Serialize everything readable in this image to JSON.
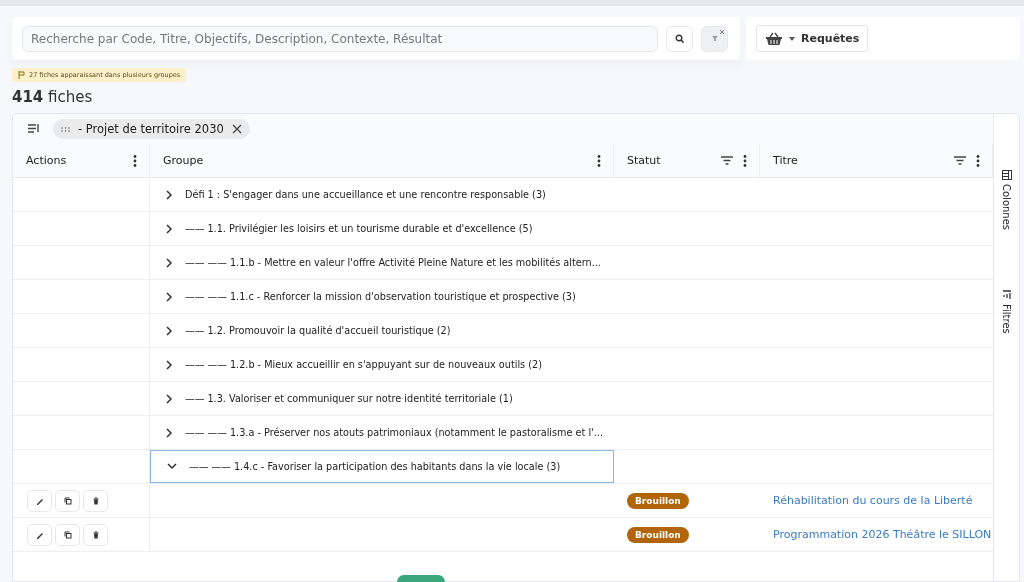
{
  "search": {
    "placeholder": "Recherche par Code, Titre, Objectifs, Description, Contexte, Résultat"
  },
  "requests_button": {
    "label": "Requêtes"
  },
  "notice": "27 fiches apparaissant dans plusieurs groupes",
  "count": {
    "number": "414",
    "label": "fiches"
  },
  "grouping_chip": {
    "label": "- Projet de territoire 2030"
  },
  "table": {
    "columns": [
      {
        "label": "Actions",
        "filter": false
      },
      {
        "label": "Groupe",
        "filter": false
      },
      {
        "label": "Statut",
        "filter": true
      },
      {
        "label": "Titre",
        "filter": true
      }
    ],
    "rows": [
      {
        "kind": "group",
        "label": "Défi 1 : S'engager dans une accueillance et une rencontre responsable (3)",
        "expanded": false,
        "selected": false
      },
      {
        "kind": "group",
        "label": "—— 1.1. Privilégier les loisirs et un tourisme durable et d'excellence (5)",
        "expanded": false,
        "selected": false
      },
      {
        "kind": "group",
        "label": "—— —— 1.1.b - Mettre en valeur l'offre Activité Pleine Nature et les mobilités altern...",
        "expanded": false,
        "selected": false
      },
      {
        "kind": "group",
        "label": "—— —— 1.1.c - Renforcer la mission d'observation touristique et prospective (3)",
        "expanded": false,
        "selected": false
      },
      {
        "kind": "group",
        "label": "—— 1.2. Promouvoir la qualité d'accueil touristique (2)",
        "expanded": false,
        "selected": false
      },
      {
        "kind": "group",
        "label": "—— —— 1.2.b - Mieux accueillir en s'appuyant sur de nouveaux outils (2)",
        "expanded": false,
        "selected": false
      },
      {
        "kind": "group",
        "label": "—— 1.3. Valoriser et communiquer sur notre identité territoriale (1)",
        "expanded": false,
        "selected": false
      },
      {
        "kind": "group",
        "label": "—— —— 1.3.a - Préserver nos atouts patrimoniaux (notamment le pastoralisme et l'...",
        "expanded": false,
        "selected": false
      },
      {
        "kind": "group",
        "label": "—— —— 1.4.c - Favoriser la participation des habitants dans la vie locale (3)",
        "expanded": true,
        "selected": true
      },
      {
        "kind": "record",
        "status": "Brouillon",
        "title": "Réhabilitation du cours de la Liberté"
      },
      {
        "kind": "record",
        "status": "Brouillon",
        "title": "Programmation 2026 Théâtre le SILLON"
      }
    ]
  },
  "side_panel": {
    "tabs": [
      "Colonnes",
      "Filtres"
    ]
  }
}
